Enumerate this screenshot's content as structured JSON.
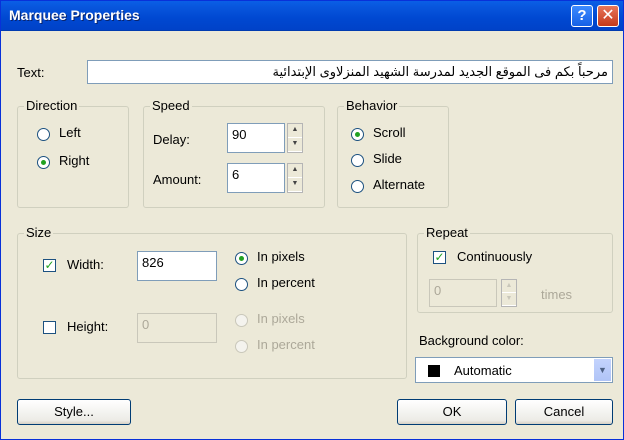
{
  "window": {
    "title": "Marquee Properties",
    "help_glyph": "?",
    "close_glyph": "✕"
  },
  "text_field": {
    "label": "Text:",
    "value": "مرحباً بكم فى الموقع الجديد لمدرسة الشهيد المنزلاوى الإبتدائية"
  },
  "direction": {
    "title": "Direction",
    "options": [
      {
        "label": "Left",
        "selected": false
      },
      {
        "label": "Right",
        "selected": true
      }
    ]
  },
  "speed": {
    "title": "Speed",
    "delay_label": "Delay:",
    "delay_value": "90",
    "amount_label": "Amount:",
    "amount_value": "6"
  },
  "behavior": {
    "title": "Behavior",
    "options": [
      {
        "label": "Scroll",
        "selected": true
      },
      {
        "label": "Slide",
        "selected": false
      },
      {
        "label": "Alternate",
        "selected": false
      }
    ]
  },
  "size": {
    "title": "Size",
    "width": {
      "label": "Width:",
      "checked": true,
      "value": "826",
      "unit_pixels": "In pixels",
      "unit_percent": "In percent",
      "unit_selected": "pixels"
    },
    "height": {
      "label": "Height:",
      "checked": false,
      "value": "0",
      "unit_pixels": "In pixels",
      "unit_percent": "In percent"
    }
  },
  "repeat": {
    "title": "Repeat",
    "continuously_label": "Continuously",
    "continuously_checked": true,
    "times_value": "0",
    "times_label": "times"
  },
  "background_color": {
    "label": "Background color:",
    "value": "Automatic",
    "swatch": "#000000"
  },
  "buttons": {
    "style": "Style...",
    "ok": "OK",
    "cancel": "Cancel"
  }
}
